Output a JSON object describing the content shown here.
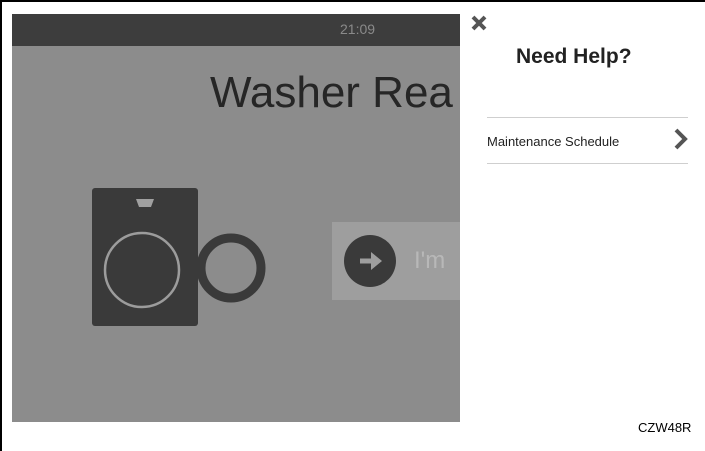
{
  "screen": {
    "clock": "21:09",
    "title": "Washer Rea",
    "ready_button_label": "I'm"
  },
  "help_panel": {
    "close_icon": "close-icon",
    "title": "Need Help?",
    "items": [
      {
        "label": "Maintenance Schedule",
        "icon": "chevron-right-icon"
      }
    ]
  },
  "figure_code": "CZW48R",
  "colors": {
    "overlay_gray": "#8c8c8c",
    "statusbar_dark": "#3d3d3d",
    "panel_bg": "#ffffff",
    "icon_gray": "#555555"
  }
}
